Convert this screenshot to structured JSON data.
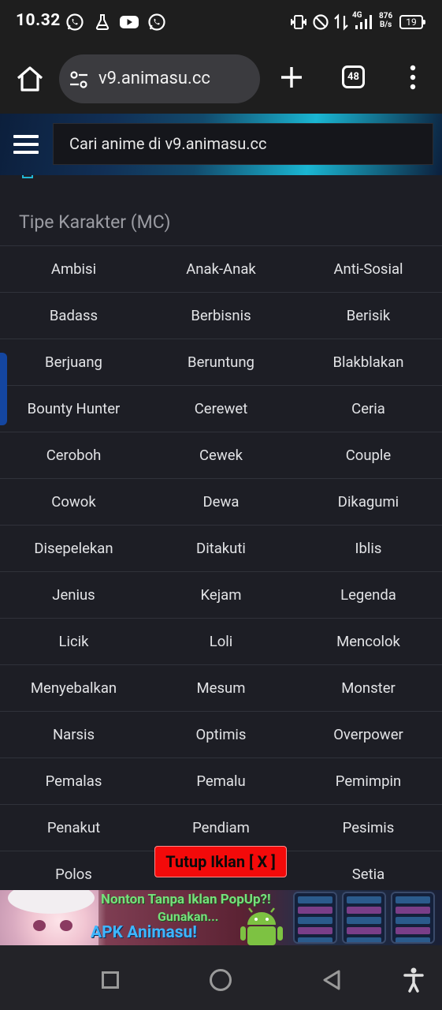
{
  "status_bar": {
    "time": "10.32",
    "network": "4G",
    "net_speed_value": "876",
    "net_speed_unit": "B/s",
    "battery": "19"
  },
  "browser": {
    "url": "v9.animasu.cc",
    "tab_count": "48"
  },
  "site": {
    "search_placeholder": "Cari anime di v9.animasu.cc",
    "section_title": "Tipe Karakter (MC)",
    "tags": [
      [
        "Ambisi",
        "Anak-Anak",
        "Anti-Sosial"
      ],
      [
        "Badass",
        "Berbisnis",
        "Berisik"
      ],
      [
        "Berjuang",
        "Beruntung",
        "Blakblakan"
      ],
      [
        "Bounty Hunter",
        "Cerewet",
        "Ceria"
      ],
      [
        "Ceroboh",
        "Cewek",
        "Couple"
      ],
      [
        "Cowok",
        "Dewa",
        "Dikagumi"
      ],
      [
        "Disepelekan",
        "Ditakuti",
        "Iblis"
      ],
      [
        "Jenius",
        "Kejam",
        "Legenda"
      ],
      [
        "Licik",
        "Loli",
        "Mencolok"
      ],
      [
        "Menyebalkan",
        "Mesum",
        "Monster"
      ],
      [
        "Narsis",
        "Optimis",
        "Overpower"
      ],
      [
        "Pemalas",
        "Pemalu",
        "Pemimpin"
      ],
      [
        "Penakut",
        "Pendiam",
        "Pesimis"
      ],
      [
        "Polos",
        "",
        "Setia"
      ]
    ]
  },
  "ad": {
    "close_label": "Tutup Iklan [ X ]",
    "line1": "Nonton Tanpa Iklan PopUp?!",
    "line2": "Gunakan...",
    "line3": "APK Animasu!"
  },
  "colors": {
    "page_bg": "#1d1e25",
    "accent_cyan": "#22b7d6",
    "close_button_red": "#f30a0a"
  },
  "icons": {
    "status": [
      "whatsapp-icon",
      "flask-icon",
      "youtube-icon",
      "whatsapp-icon",
      "vibrate-icon",
      "do-not-disturb-icon",
      "data-arrows-icon",
      "signal-icon",
      "battery-icon"
    ],
    "browser": [
      "home-icon",
      "site-settings-icon",
      "plus-icon",
      "tab-switcher-icon",
      "more-vert-icon"
    ],
    "nav": [
      "recents-square-icon",
      "home-circle-icon",
      "back-triangle-icon",
      "accessibility-icon"
    ]
  }
}
